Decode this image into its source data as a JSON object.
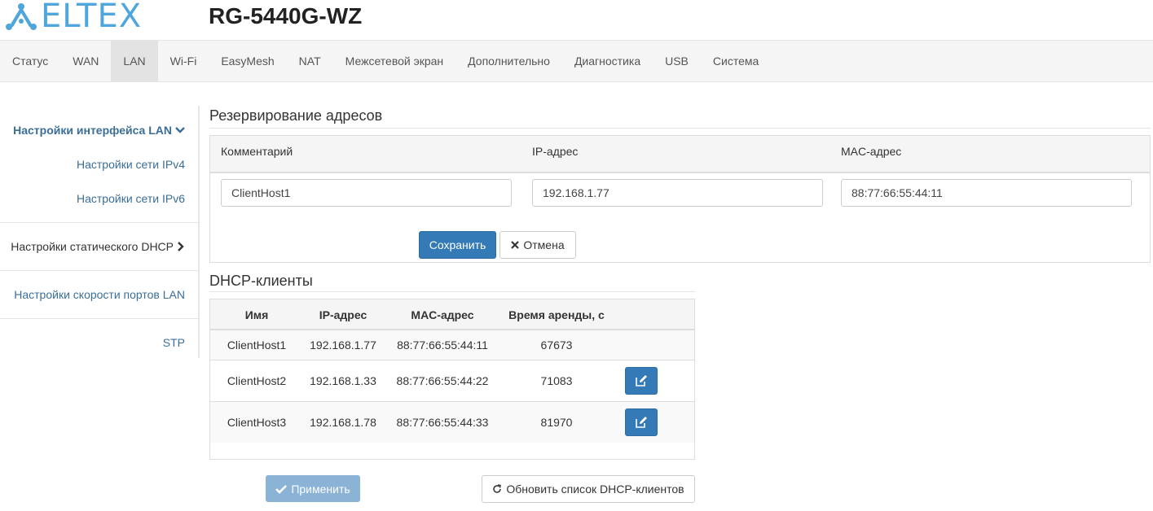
{
  "brand": {
    "logo_text": "ELTEX",
    "accent": "#4fa6dd"
  },
  "header": {
    "model": "RG-5440G-WZ"
  },
  "nav": {
    "items": [
      {
        "label": "Статус"
      },
      {
        "label": "WAN"
      },
      {
        "label": "LAN",
        "active": true
      },
      {
        "label": "Wi-Fi"
      },
      {
        "label": "EasyMesh"
      },
      {
        "label": "NAT"
      },
      {
        "label": "Межсетевой экран"
      },
      {
        "label": "Дополнительно"
      },
      {
        "label": "Диагностика"
      },
      {
        "label": "USB"
      },
      {
        "label": "Система"
      }
    ]
  },
  "sidebar": {
    "group_title": "Настройки интерфейса LAN",
    "group_icon": "chevron-down-icon",
    "subitems": [
      "Настройки сети IPv4",
      "Настройки сети IPv6"
    ],
    "static_dhcp": "Настройки статического DHCP",
    "static_dhcp_icon": "chevron-right-icon",
    "port_speed": "Настройки скорости портов LAN",
    "stp": "STP"
  },
  "reservation": {
    "title": "Резервирование адресов",
    "columns": [
      "Комментарий",
      "IP-адрес",
      "MAC-адрес"
    ],
    "comment_value": "ClientHost1",
    "ip_value": "192.168.1.77",
    "mac_value": "88:77:66:55:44:11",
    "save_label": "Сохранить",
    "cancel_label": "Отмена",
    "cancel_icon": "close-icon"
  },
  "dhcp_clients": {
    "title": "DHCP-клиенты",
    "columns": [
      "Имя",
      "IP-адрес",
      "MAC-адрес",
      "Время аренды, с"
    ],
    "rows": [
      {
        "name": "ClientHost1",
        "ip": "192.168.1.77",
        "mac": "88:77:66:55:44:11",
        "lease": "67673",
        "editable": false
      },
      {
        "name": "ClientHost2",
        "ip": "192.168.1.33",
        "mac": "88:77:66:55:44:22",
        "lease": "71083",
        "editable": true
      },
      {
        "name": "ClientHost3",
        "ip": "192.168.1.78",
        "mac": "88:77:66:55:44:33",
        "lease": "81970",
        "editable": true
      }
    ],
    "edit_icon": "edit-icon"
  },
  "footer": {
    "apply_label": "Применить",
    "apply_icon": "check-icon",
    "refresh_label": "Обновить список DHCP-клиентов",
    "refresh_icon": "refresh-icon"
  },
  "colors": {
    "primary": "#337ab7",
    "link": "#3a6e98",
    "disabled_primary": "#8ab3d6"
  }
}
